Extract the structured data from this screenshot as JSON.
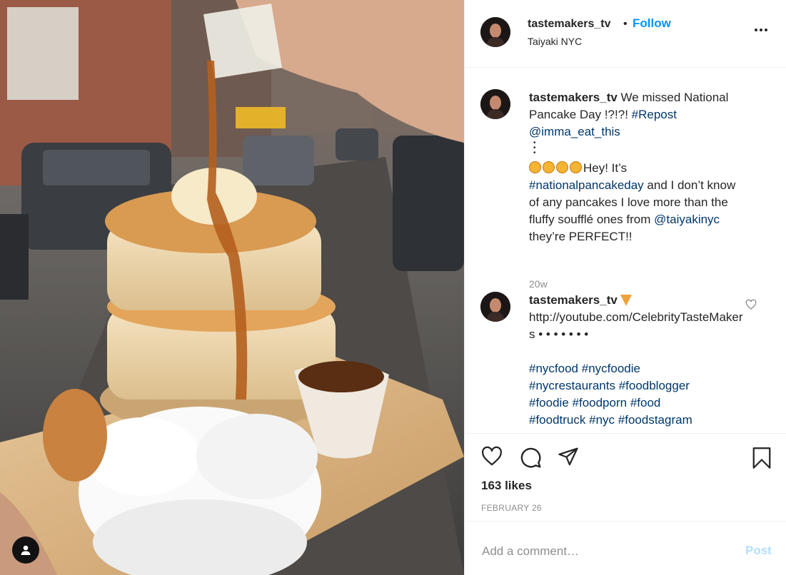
{
  "post": {
    "username": "tastemakers_tv",
    "follow_label": "Follow",
    "separator": "•",
    "location": "Taiyaki NYC"
  },
  "caption": {
    "username": "tastemakers_tv",
    "text1": "We missed National Pancake Day !?!?!",
    "tag_repost": "#Repost",
    "mention1": "@imma_eat_this",
    "dots": "•\n•\n•",
    "text2": "Hey! It’s",
    "tag_day": "#nationalpancakeday",
    "text3": "and I don’t know of any pancakes I love more than the fluffy soufflé ones from",
    "mention2": "@taiyakinyc",
    "text4": "they’re PERFECT!!",
    "time": "20w"
  },
  "reply": {
    "username": "tastemakers_tv",
    "link": "http://youtube.com/CelebrityTasteMakers",
    "dots": "• • • • • • •",
    "tags": [
      "#nycfood",
      "#nycfoodie",
      "#nycrestaurants",
      "#foodblogger",
      "#foodie",
      "#foodporn",
      "#food",
      "#foodtruck",
      "#nyc",
      "#foodstagram"
    ]
  },
  "engagement": {
    "likes": "163 likes",
    "date": "FEBRUARY 26"
  },
  "comment_box": {
    "placeholder": "Add a comment…",
    "post_label": "Post"
  },
  "icons": {
    "like": "heart-icon",
    "comment": "comment-icon",
    "share": "paper-plane-icon",
    "save": "bookmark-icon",
    "more": "more-options-icon",
    "user_tags": "user-icon"
  },
  "colors": {
    "accent": "#0095f6",
    "tag": "#00376b",
    "muted": "#8e8e8e",
    "post_disabled": "#b2dffc"
  }
}
